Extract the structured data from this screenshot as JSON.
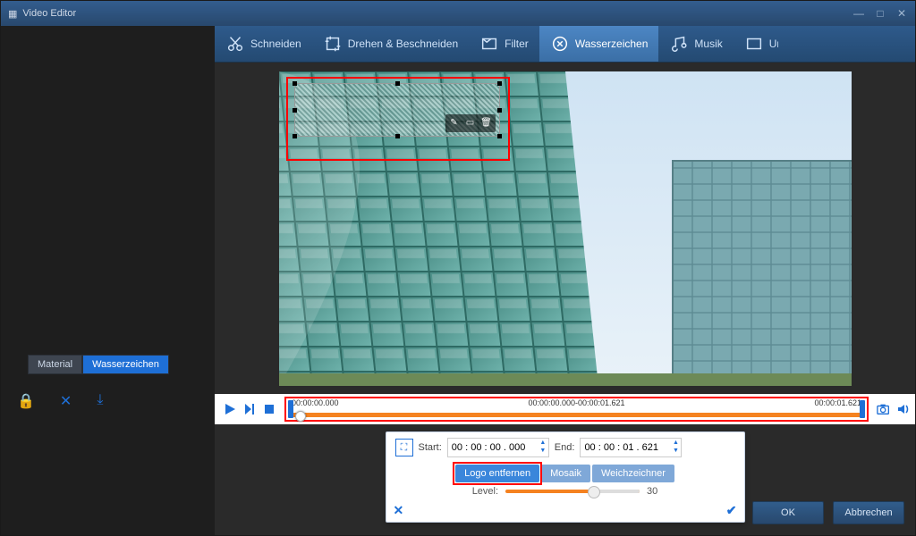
{
  "title": "Video Editor",
  "tabs": [
    {
      "label": "Schneiden"
    },
    {
      "label": "Drehen & Beschneiden"
    },
    {
      "label": "Filter"
    },
    {
      "label": "Wasserzeichen"
    },
    {
      "label": "Musik"
    },
    {
      "label": "Untertitel"
    }
  ],
  "active_tab_index": 3,
  "timeline": {
    "start": "00:00:00.000",
    "range": "00:00:00.000-00:00:01.621",
    "end": "00:00:01.621"
  },
  "panel": {
    "start_label": "Start:",
    "start_value": "00 : 00 : 00 . 000",
    "end_label": "End:",
    "end_value": "00 : 00 : 01 . 621",
    "modes": [
      {
        "label": "Logo entfernen"
      },
      {
        "label": "Mosaik"
      },
      {
        "label": "Weichzeichner"
      }
    ],
    "active_mode_index": 0,
    "level_label": "Level:",
    "level_value": "30"
  },
  "sidebar": {
    "tabs": [
      {
        "label": "Material"
      },
      {
        "label": "Wasserzeichen"
      }
    ],
    "active_index": 1
  },
  "buttons": {
    "ok": "OK",
    "cancel": "Abbrechen"
  },
  "colors": {
    "accent": "#1e6fd6",
    "highlight": "#f00",
    "timeline": "#f58220"
  }
}
